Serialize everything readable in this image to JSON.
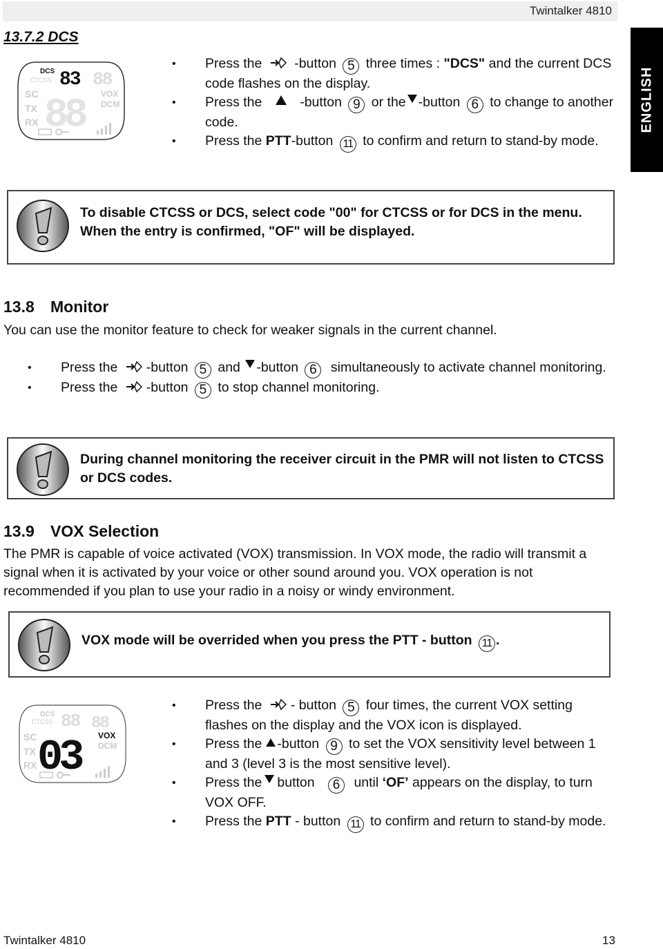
{
  "header": {
    "title": "Twintalker 4810"
  },
  "language_tab": "ENGLISH",
  "section_dcs": {
    "heading": "13.7.2 DCS",
    "lcd": {
      "active_labels": [
        "DCS"
      ],
      "digits_small": "83",
      "inactive_labels": [
        "CTCSS",
        "SC",
        "TX",
        "RX",
        "VOX",
        "DCM"
      ]
    },
    "bullets": [
      {
        "pre": "Press the",
        "icon": "mode-button-icon",
        "mid": "-button",
        "num": "5",
        "post_plain": "three times :",
        "post_bold": "\"DCS\"",
        "post_tail": "and the current DCS code flashes on the display."
      },
      {
        "pre": "Press the",
        "icon": "up-triangle-icon",
        "mid": "-button",
        "num": "9",
        "mid2": "or the",
        "icon2": "down-triangle-icon",
        "mid3": "-button",
        "num2": "6",
        "post": "to change to another code."
      },
      {
        "pre": "Press the",
        "bold": "PTT",
        "mid": "-button",
        "num": "11",
        "post": "to confirm and return to stand-by mode."
      }
    ],
    "note": "To disable CTCSS or DCS, select code \"00\" for CTCSS or for DCS in the menu. When the entry is confirmed, \"OF\" will be displayed."
  },
  "section_monitor": {
    "number": "13.8",
    "title": "Monitor",
    "intro": "You can use the monitor feature to check for weaker signals in the current channel.",
    "bullets": [
      {
        "pre": "Press the",
        "mid": "-button",
        "num": "5",
        "and": "and",
        "mid2": "-button",
        "num2": "6",
        "post": "simultaneously to activate channel monitoring."
      },
      {
        "pre": "Press the",
        "mid": "-button",
        "num": "5",
        "post": "to stop channel monitoring."
      }
    ],
    "note": "During channel monitoring the receiver circuit in the PMR will not listen to CTCSS or DCS codes."
  },
  "section_vox": {
    "number": "13.9",
    "title": "VOX Selection",
    "intro": "The PMR is capable of voice activated (VOX) transmission. In VOX mode, the radio will transmit a signal when it is activated by your voice or other sound around you. VOX operation is not recommended if you plan to use your radio in a noisy or windy environment.",
    "note_pre": "VOX mode will be overrided when you press the PTT - button",
    "note_num": "11",
    "note_post": ".",
    "lcd": {
      "active_labels": [
        "VOX"
      ],
      "digits_large": "03",
      "inactive_labels": [
        "DCS",
        "CTCSS",
        "SC",
        "TX",
        "RX",
        "DCM"
      ]
    },
    "bullets": [
      {
        "pre": "Press the",
        "mid": "- button",
        "num": "5",
        "post": "four times, the current VOX setting flashes on the display and the VOX icon is displayed."
      },
      {
        "pre": "Press the",
        "mid": "-button",
        "num": "9",
        "post": "to set the VOX sensitivity level between 1 and 3 (level 3 is the most sensitive level)."
      },
      {
        "pre": "Press the",
        "mid": "button",
        "num": "6",
        "post_pre": "until",
        "post_bold": "‘OF’",
        "post": "appears on the display, to turn VOX OFF."
      },
      {
        "pre": "Press the",
        "bold": "PTT",
        "mid": "- button",
        "num": "11",
        "post": "to confirm and return to stand-by mode."
      }
    ]
  },
  "footer": {
    "left": "Twintalker 4810",
    "page": "13"
  }
}
